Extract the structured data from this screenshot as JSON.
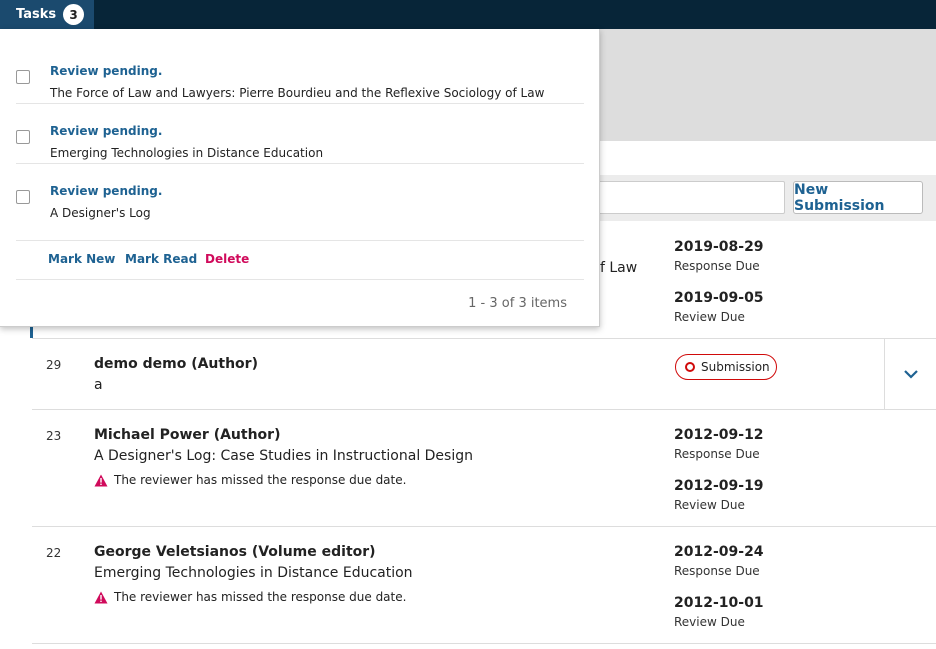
{
  "topbar": {
    "tasks_label": "Tasks",
    "tasks_count": "3"
  },
  "tasks_panel": {
    "tasks": [
      {
        "status": "Review pending.",
        "title": "The Force of Law and Lawyers: Pierre Bourdieu and the Reflexive Sociology of Law"
      },
      {
        "status": "Review pending.",
        "title": "Emerging Technologies in Distance Education"
      },
      {
        "status": "Review pending.",
        "title": "A Designer's Log"
      }
    ],
    "actions": {
      "mark_new": "Mark New",
      "mark_read": "Mark Read",
      "delete": "Delete"
    },
    "pagination": "1 - 3 of 3 items"
  },
  "toolbar": {
    "new_submission": "New Submission"
  },
  "submissions": [
    {
      "title_fragment": "f Law",
      "dates": [
        {
          "date": "2019-08-29",
          "label": "Response Due"
        },
        {
          "date": "2019-09-05",
          "label": "Review Due"
        }
      ]
    },
    {
      "id": "29",
      "author": "demo demo (Author)",
      "title": "a",
      "stage": "Submission"
    },
    {
      "id": "23",
      "author": "Michael Power (Author)",
      "title": "A Designer's Log: Case Studies in Instructional Design",
      "warning": "The reviewer has missed the response due date.",
      "dates": [
        {
          "date": "2012-09-12",
          "label": "Response Due"
        },
        {
          "date": "2012-09-19",
          "label": "Review Due"
        }
      ]
    },
    {
      "id": "22",
      "author": "George Veletsianos (Volume editor)",
      "title": "Emerging Technologies in Distance Education",
      "warning": "The reviewer has missed the response due date.",
      "dates": [
        {
          "date": "2012-09-24",
          "label": "Response Due"
        },
        {
          "date": "2012-10-01",
          "label": "Review Due"
        }
      ]
    }
  ],
  "colors": {
    "topbar": "#072538",
    "tasks_button": "#1b4a6e",
    "link": "#1e6292",
    "danger": "#d00a5b",
    "stage_badge": "#d00a0a"
  }
}
